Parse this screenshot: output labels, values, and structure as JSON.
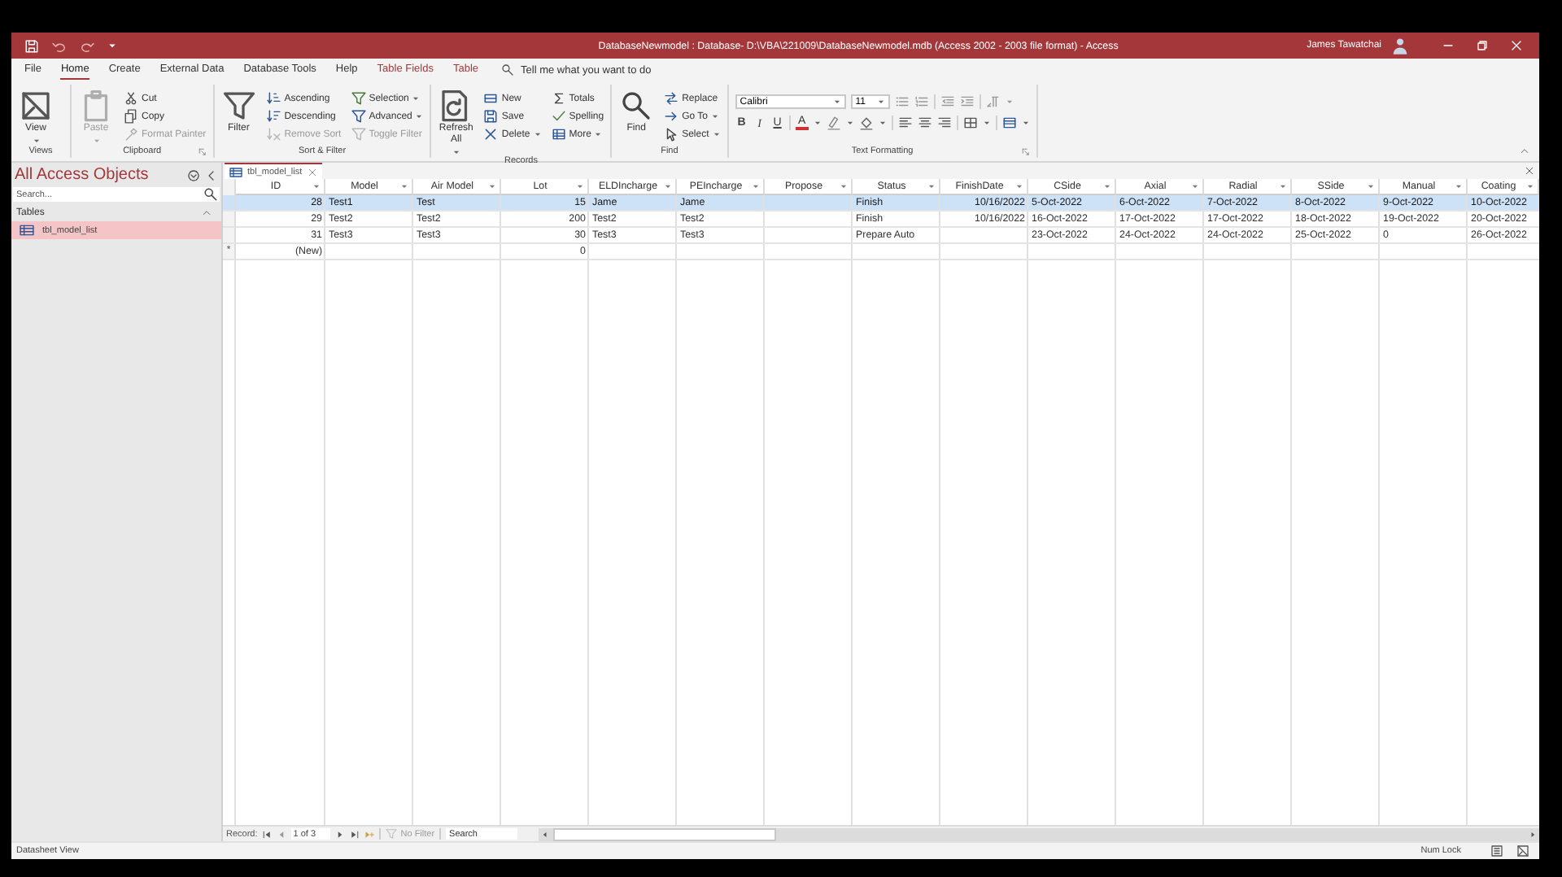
{
  "window": {
    "title": "DatabaseNewmodel : Database- D:\\VBA\\221009\\DatabaseNewmodel.mdb (Access 2002 - 2003 file format)  -  Access",
    "user": "James Tawatchai"
  },
  "ribbon_tabs": [
    {
      "label": "File",
      "selected": false,
      "kind": "normal"
    },
    {
      "label": "Home",
      "selected": true,
      "kind": "normal"
    },
    {
      "label": "Create",
      "selected": false,
      "kind": "normal"
    },
    {
      "label": "External Data",
      "selected": false,
      "kind": "normal"
    },
    {
      "label": "Database Tools",
      "selected": false,
      "kind": "normal"
    },
    {
      "label": "Help",
      "selected": false,
      "kind": "normal"
    },
    {
      "label": "Table Fields",
      "selected": false,
      "kind": "contextual"
    },
    {
      "label": "Table",
      "selected": false,
      "kind": "contextual"
    }
  ],
  "tell_me": {
    "placeholder": "Tell me what you want to do"
  },
  "ribbon_groups": [
    {
      "name": "Views",
      "launcher": false,
      "commands": [
        {
          "label": "View",
          "kind": "large",
          "disabled": false,
          "dropdown": true
        }
      ]
    },
    {
      "name": "Clipboard",
      "launcher": true,
      "commands": [
        {
          "label": "Paste",
          "kind": "large",
          "disabled": true,
          "dropdown": true
        },
        {
          "label": "Cut",
          "kind": "small",
          "disabled": false,
          "dropdown": false
        },
        {
          "label": "Copy",
          "kind": "small",
          "disabled": false,
          "dropdown": false
        },
        {
          "label": "Format Painter",
          "kind": "small",
          "disabled": true,
          "dropdown": false
        }
      ]
    },
    {
      "name": "Sort & Filter",
      "launcher": false,
      "commands": [
        {
          "label": "Filter",
          "kind": "large",
          "disabled": false,
          "dropdown": false
        },
        {
          "label": "Ascending",
          "kind": "small",
          "disabled": false,
          "dropdown": false
        },
        {
          "label": "Descending",
          "kind": "small",
          "disabled": false,
          "dropdown": false
        },
        {
          "label": "Remove Sort",
          "kind": "small",
          "disabled": true,
          "dropdown": false
        },
        {
          "label": "Selection",
          "kind": "small",
          "disabled": false,
          "dropdown": true
        },
        {
          "label": "Advanced",
          "kind": "small",
          "disabled": false,
          "dropdown": true
        },
        {
          "label": "Toggle Filter",
          "kind": "small",
          "disabled": true,
          "dropdown": false
        }
      ]
    },
    {
      "name": "Records",
      "launcher": false,
      "commands": [
        {
          "label": "Refresh All",
          "kind": "large",
          "disabled": false,
          "dropdown": true
        },
        {
          "label": "New",
          "kind": "small",
          "disabled": false,
          "dropdown": false
        },
        {
          "label": "Save",
          "kind": "small",
          "disabled": false,
          "dropdown": false
        },
        {
          "label": "Delete",
          "kind": "small",
          "disabled": false,
          "dropdown": true
        },
        {
          "label": "Totals",
          "kind": "small",
          "disabled": false,
          "dropdown": false
        },
        {
          "label": "Spelling",
          "kind": "small",
          "disabled": false,
          "dropdown": false
        },
        {
          "label": "More",
          "kind": "small",
          "disabled": false,
          "dropdown": true
        }
      ]
    },
    {
      "name": "Find",
      "launcher": false,
      "commands": [
        {
          "label": "Find",
          "kind": "large",
          "disabled": false,
          "dropdown": false
        },
        {
          "label": "Replace",
          "kind": "small",
          "disabled": false,
          "dropdown": false
        },
        {
          "label": "Go To",
          "kind": "small",
          "disabled": false,
          "dropdown": true
        },
        {
          "label": "Select",
          "kind": "small",
          "disabled": false,
          "dropdown": true
        }
      ]
    }
  ],
  "text_formatting": {
    "name": "Text Formatting",
    "launcher": true,
    "font": "Calibri",
    "size": "11",
    "bold": "B",
    "italic": "I",
    "underline": "U",
    "font_color": "A"
  },
  "nav_pane": {
    "title": "All Access Objects",
    "search": {
      "placeholder": "Search..."
    },
    "sections": [
      {
        "label": "Tables",
        "expanded": true,
        "items": [
          {
            "label": "tbl_model_list",
            "selected": true
          }
        ]
      }
    ]
  },
  "document_tabs": [
    {
      "label": "tbl_model_list",
      "selected": true
    }
  ],
  "table": {
    "columns": [
      {
        "label": "ID",
        "kind": "number"
      },
      {
        "label": "Model",
        "kind": "text"
      },
      {
        "label": "Air Model",
        "kind": "text"
      },
      {
        "label": "Lot",
        "kind": "number"
      },
      {
        "label": "ELDIncharge",
        "kind": "text"
      },
      {
        "label": "PEIncharge",
        "kind": "text"
      },
      {
        "label": "Propose",
        "kind": "text"
      },
      {
        "label": "Status",
        "kind": "text"
      },
      {
        "label": "FinishDate",
        "kind": "number"
      },
      {
        "label": "CSide",
        "kind": "text"
      },
      {
        "label": "Axial",
        "kind": "text"
      },
      {
        "label": "Radial",
        "kind": "text"
      },
      {
        "label": "SSide",
        "kind": "text"
      },
      {
        "label": "Manual",
        "kind": "text"
      },
      {
        "label": "Coating",
        "kind": "text"
      }
    ],
    "rows": [
      {
        "selected": true,
        "cells": [
          "28",
          "Test1",
          "Test",
          "15",
          "Jame",
          "Jame",
          null,
          "Finish",
          "10/16/2022",
          "5-Oct-2022",
          "6-Oct-2022",
          "7-Oct-2022",
          "8-Oct-2022",
          "9-Oct-2022",
          "10-Oct-2022"
        ]
      },
      {
        "selected": false,
        "cells": [
          "29",
          "Test2",
          "Test2",
          "200",
          "Test2",
          "Test2",
          null,
          "Finish",
          "10/16/2022",
          "16-Oct-2022",
          "17-Oct-2022",
          "17-Oct-2022",
          "18-Oct-2022",
          "19-Oct-2022",
          "20-Oct-2022"
        ]
      },
      {
        "selected": false,
        "cells": [
          "31",
          "Test3",
          "Test3",
          "30",
          "Test3",
          "Test3",
          null,
          "Prepare Auto",
          null,
          "23-Oct-2022",
          "24-Oct-2022",
          "24-Oct-2022",
          "25-Oct-2022",
          "0",
          "26-Oct-2022"
        ]
      }
    ],
    "new_row": {
      "marker": "*",
      "cells": [
        "(New)",
        null,
        null,
        "0",
        null,
        null,
        null,
        null,
        null,
        null,
        null,
        null,
        null,
        null,
        null
      ]
    }
  },
  "record_navigator": {
    "label": "Record:",
    "position": "1 of 3",
    "filter": {
      "label": "No Filter",
      "disabled": true
    },
    "search": {
      "placeholder": "Search"
    }
  },
  "status_bar": {
    "view": "Datasheet View",
    "indicators": [
      "Num Lock"
    ]
  }
}
